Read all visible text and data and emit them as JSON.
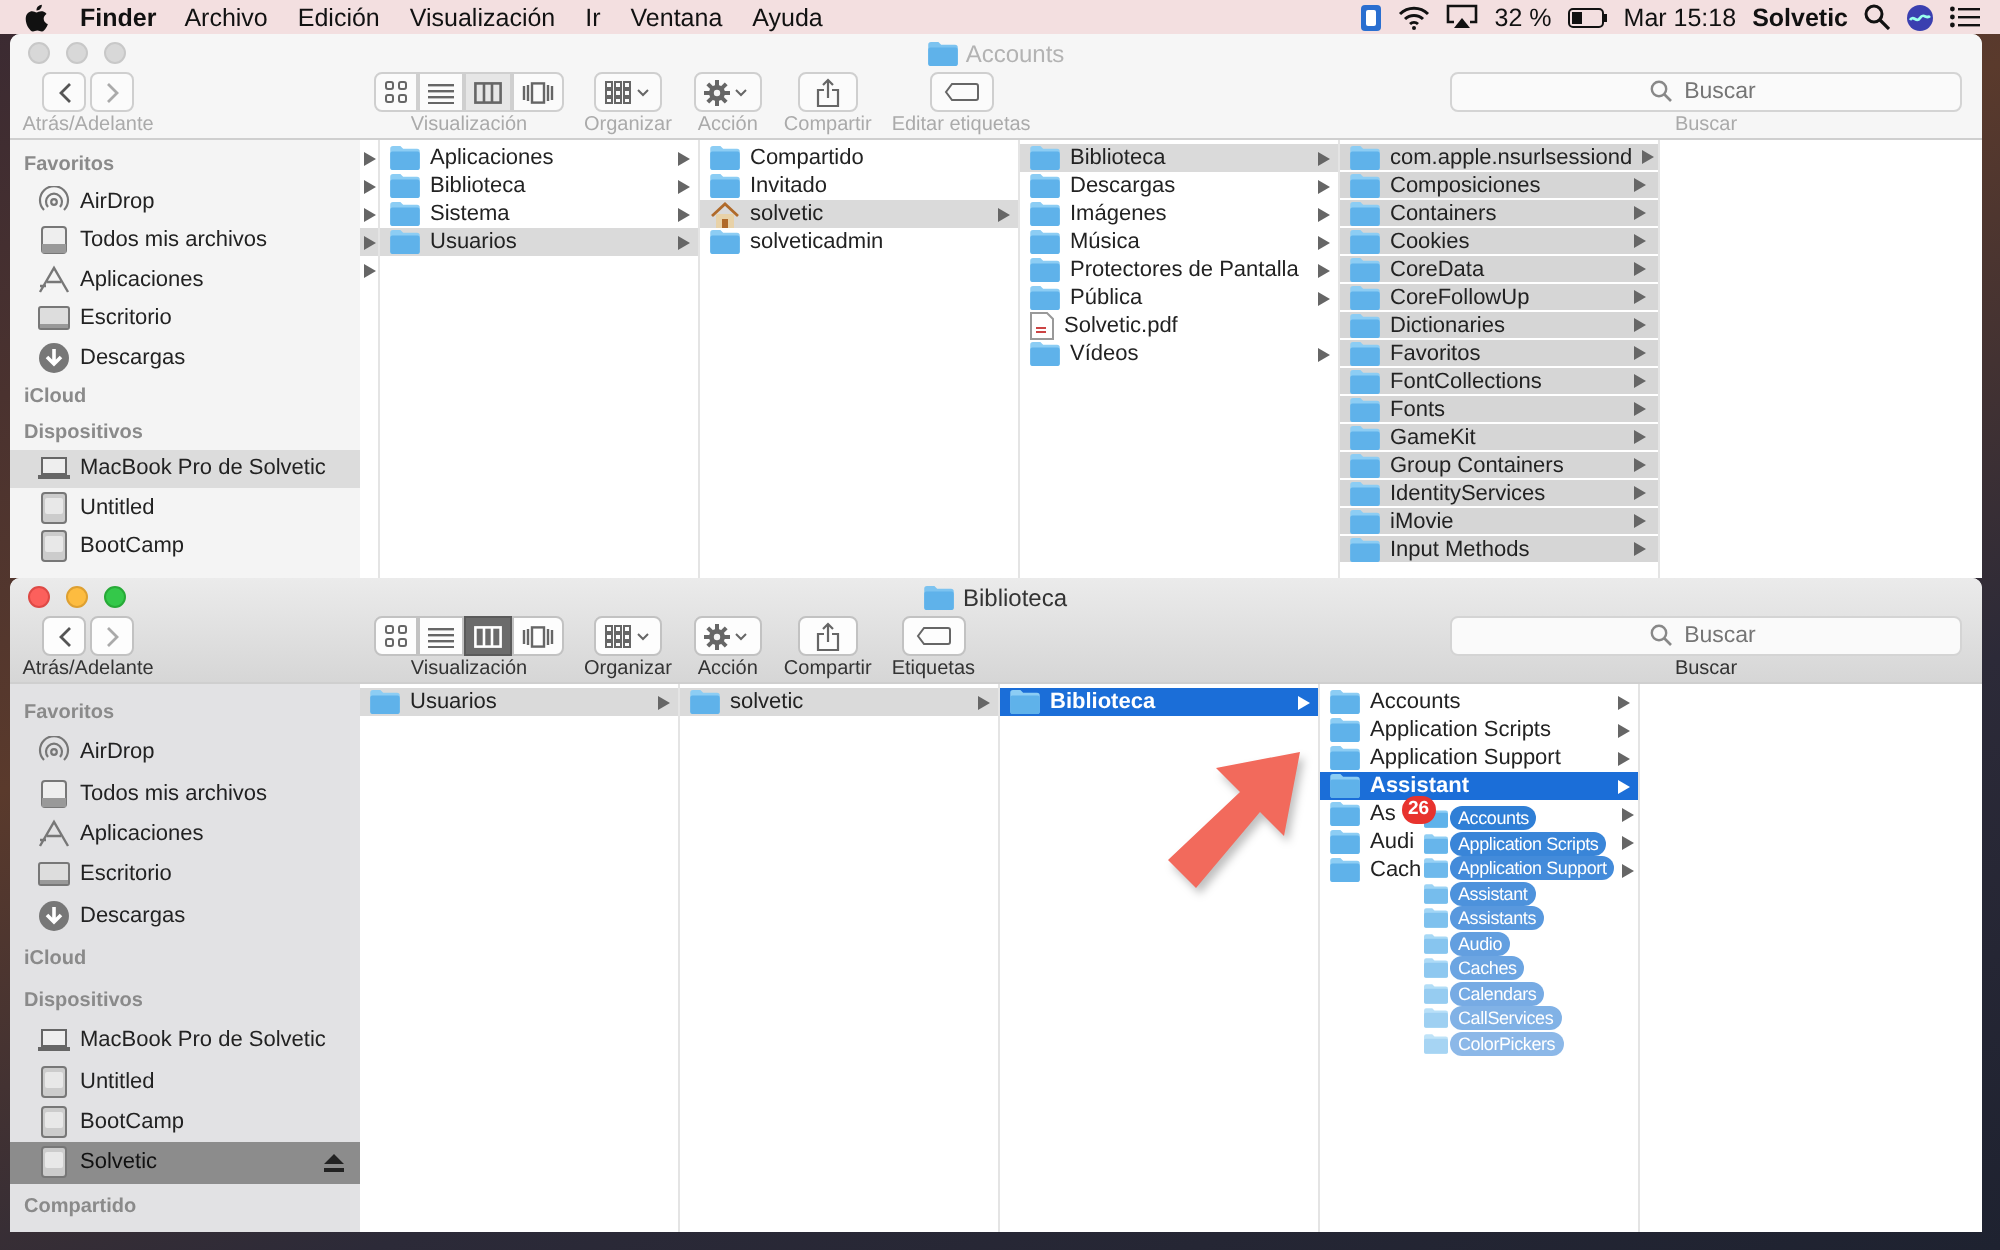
{
  "menu_bar": {
    "app": "Finder",
    "menus": [
      "Archivo",
      "Edición",
      "Visualización",
      "Ir",
      "Ventana",
      "Ayuda"
    ],
    "battery": "32 %",
    "clock": "Mar 15:18",
    "user": "Solvetic"
  },
  "windows": [
    {
      "title": "Accounts",
      "active": false,
      "toolbar": {
        "nav_label": "Atrás/Adelante",
        "view_modes": [
          {
            "selected": false
          },
          {
            "selected": false
          },
          {
            "selected": true
          },
          {
            "selected": false
          }
        ],
        "view_label": "Visualización",
        "arrange_label": "Organizar",
        "action_label": "Acción",
        "share_label": "Compartir",
        "tags_label": "Editar etiquetas",
        "search": {
          "placeholder": "Buscar",
          "label": "Buscar"
        }
      },
      "sidebar": [
        {
          "heading": "Favoritos",
          "items": [
            {
              "label": "AirDrop",
              "kind": "airdrop",
              "selected": false,
              "eject": false
            },
            {
              "label": "Todos mis archivos",
              "kind": "documents",
              "selected": false,
              "eject": false
            },
            {
              "label": "Aplicaciones",
              "kind": "apps",
              "selected": false,
              "eject": false
            },
            {
              "label": "Escritorio",
              "kind": "desktop",
              "selected": false,
              "eject": false
            },
            {
              "label": "Descargas",
              "kind": "downloads",
              "selected": false,
              "eject": false
            }
          ]
        },
        {
          "heading": "iCloud"
        },
        {
          "heading": "Dispositivos",
          "items": [
            {
              "label": "MacBook Pro de Solvetic",
              "kind": "laptop",
              "selected": true,
              "eject": false
            },
            {
              "label": "Untitled",
              "kind": "disk",
              "selected": false,
              "eject": false
            },
            {
              "label": "BootCamp",
              "kind": "disk",
              "selected": false,
              "eject": false
            }
          ]
        }
      ],
      "columns": [
        {
          "kind": "stub",
          "focused": false,
          "items": [
            {
              "arrow": true,
              "selected": false
            },
            {
              "arrow": true,
              "selected": false
            },
            {
              "arrow": true,
              "selected": false
            },
            {
              "arrow": true,
              "selected": true
            },
            {
              "arrow": true,
              "selected": false
            }
          ]
        },
        {
          "kind": "list",
          "focused": false,
          "items": [
            {
              "name": "Aplicaciones",
              "kind": "folder",
              "arrow": true,
              "selected": false
            },
            {
              "name": "Biblioteca",
              "kind": "folder",
              "arrow": true,
              "selected": false
            },
            {
              "name": "Sistema",
              "kind": "folder",
              "arrow": true,
              "selected": false
            },
            {
              "name": "Usuarios",
              "kind": "folder",
              "arrow": true,
              "selected": true
            }
          ]
        },
        {
          "kind": "list",
          "focused": false,
          "items": [
            {
              "name": "Compartido",
              "kind": "folder",
              "arrow": false,
              "selected": false
            },
            {
              "name": "Invitado",
              "kind": "folder",
              "arrow": false,
              "selected": false
            },
            {
              "name": "solvetic",
              "kind": "home",
              "arrow": true,
              "selected": true
            },
            {
              "name": "solveticadmin",
              "kind": "folder",
              "arrow": false,
              "selected": false
            }
          ]
        },
        {
          "kind": "list",
          "focused": false,
          "items": [
            {
              "name": "Biblioteca",
              "kind": "folder",
              "arrow": true,
              "selected": true
            },
            {
              "name": "Descargas",
              "kind": "folder",
              "arrow": true,
              "selected": false
            },
            {
              "name": "Imágenes",
              "kind": "folder",
              "arrow": true,
              "selected": false
            },
            {
              "name": "Música",
              "kind": "folder",
              "arrow": true,
              "selected": false
            },
            {
              "name": "Protectores de Pantalla",
              "kind": "folder",
              "arrow": true,
              "selected": false
            },
            {
              "name": "Pública",
              "kind": "folder",
              "arrow": true,
              "selected": false
            },
            {
              "name": "Solvetic.pdf",
              "kind": "document",
              "arrow": false,
              "selected": false
            },
            {
              "name": "Vídeos",
              "kind": "folder",
              "arrow": true,
              "selected": false
            }
          ]
        },
        {
          "kind": "list",
          "focused": false,
          "items": [
            {
              "name": "com.apple.nsurlsessiond",
              "kind": "folder",
              "arrow": true,
              "selected": true
            },
            {
              "name": "Composiciones",
              "kind": "folder",
              "arrow": true,
              "selected": true
            },
            {
              "name": "Containers",
              "kind": "folder",
              "arrow": true,
              "selected": true
            },
            {
              "name": "Cookies",
              "kind": "folder",
              "arrow": true,
              "selected": true
            },
            {
              "name": "CoreData",
              "kind": "folder",
              "arrow": true,
              "selected": true
            },
            {
              "name": "CoreFollowUp",
              "kind": "folder",
              "arrow": true,
              "selected": true
            },
            {
              "name": "Dictionaries",
              "kind": "folder",
              "arrow": true,
              "selected": true
            },
            {
              "name": "Favoritos",
              "kind": "folder",
              "arrow": true,
              "selected": true
            },
            {
              "name": "FontCollections",
              "kind": "folder",
              "arrow": true,
              "selected": true
            },
            {
              "name": "Fonts",
              "kind": "folder",
              "arrow": true,
              "selected": true
            },
            {
              "name": "GameKit",
              "kind": "folder",
              "arrow": true,
              "selected": true
            },
            {
              "name": "Group Containers",
              "kind": "folder",
              "arrow": true,
              "selected": true
            },
            {
              "name": "IdentityServices",
              "kind": "folder",
              "arrow": true,
              "selected": true
            },
            {
              "name": "iMovie",
              "kind": "folder",
              "arrow": true,
              "selected": true
            },
            {
              "name": "Input Methods",
              "kind": "folder",
              "arrow": true,
              "selected": true
            }
          ]
        }
      ]
    },
    {
      "title": "Biblioteca",
      "active": true,
      "toolbar": {
        "nav_label": "Atrás/Adelante",
        "view_modes": [
          {
            "selected": false
          },
          {
            "selected": false
          },
          {
            "selected": true
          },
          {
            "selected": false
          }
        ],
        "view_label": "Visualización",
        "arrange_label": "Organizar",
        "action_label": "Acción",
        "share_label": "Compartir",
        "tags_label": "Etiquetas",
        "search": {
          "placeholder": "Buscar",
          "label": "Buscar"
        }
      },
      "sidebar": [
        {
          "heading": "Favoritos",
          "items": [
            {
              "label": "AirDrop",
              "kind": "airdrop",
              "selected": false,
              "eject": false
            },
            {
              "label": "Todos mis archivos",
              "kind": "documents",
              "selected": false,
              "eject": false
            },
            {
              "label": "Aplicaciones",
              "kind": "apps",
              "selected": false,
              "eject": false
            },
            {
              "label": "Escritorio",
              "kind": "desktop",
              "selected": false,
              "eject": false
            },
            {
              "label": "Descargas",
              "kind": "downloads",
              "selected": false,
              "eject": false
            }
          ]
        },
        {
          "heading": "iCloud"
        },
        {
          "heading": "Dispositivos",
          "items": [
            {
              "label": "MacBook Pro de Solvetic",
              "kind": "laptop",
              "selected": false,
              "eject": false
            },
            {
              "label": "Untitled",
              "kind": "disk",
              "selected": false,
              "eject": false
            },
            {
              "label": "BootCamp",
              "kind": "disk",
              "selected": false,
              "eject": false
            },
            {
              "label": "Solvetic",
              "kind": "disk",
              "selected": true,
              "eject": true
            }
          ]
        },
        {
          "heading": "Compartido"
        }
      ],
      "columns": [
        {
          "kind": "list",
          "focused": false,
          "items": [
            {
              "name": "Usuarios",
              "kind": "folder",
              "arrow": true,
              "selected": true
            }
          ]
        },
        {
          "kind": "list",
          "focused": false,
          "items": [
            {
              "name": "solvetic",
              "kind": "folder",
              "arrow": true,
              "selected": true
            }
          ]
        },
        {
          "kind": "list",
          "focused": true,
          "items": [
            {
              "name": "Biblioteca",
              "kind": "folder",
              "arrow": true,
              "selected": true
            }
          ]
        },
        {
          "kind": "list",
          "focused": true,
          "items": [
            {
              "name": "Accounts",
              "kind": "folder",
              "arrow": true,
              "selected": false
            },
            {
              "name": "Application Scripts",
              "kind": "folder",
              "arrow": true,
              "selected": false
            },
            {
              "name": "Application Support",
              "kind": "folder",
              "arrow": true,
              "selected": false
            },
            {
              "name": "Assistant",
              "kind": "folder",
              "arrow": true,
              "selected": true
            },
            {
              "name": "As",
              "kind": "folder",
              "arrow": true,
              "selected": false
            },
            {
              "name": "Audi",
              "kind": "folder",
              "arrow": true,
              "selected": false
            },
            {
              "name": "Cach",
              "kind": "folder",
              "arrow": true,
              "selected": false
            }
          ]
        }
      ],
      "drag": {
        "count": "26",
        "items": [
          "Accounts",
          "Application Scripts",
          "Application Support",
          "Assistant",
          "Assistants",
          "Audio",
          "Caches",
          "Calendars",
          "CallServices",
          "ColorPickers"
        ]
      }
    }
  ]
}
